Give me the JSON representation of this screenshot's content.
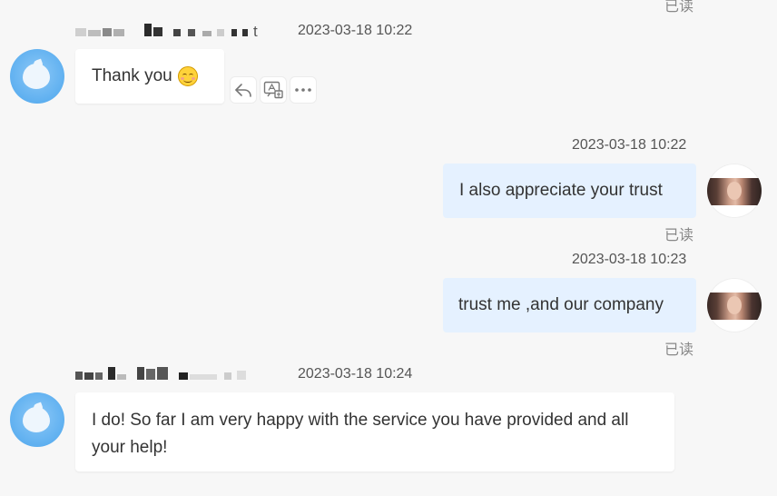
{
  "messages": [
    {
      "read_status": "已读"
    },
    {
      "sender_tail": "t",
      "timestamp": "2023-03-18 10:22",
      "text": "Thank you"
    },
    {
      "timestamp": "2023-03-18 10:22",
      "text": "I also appreciate your trust",
      "read_status": "已读"
    },
    {
      "timestamp": "2023-03-18 10:23",
      "text": "trust me ,and our company",
      "read_status": "已读"
    },
    {
      "timestamp": "2023-03-18 10:24",
      "text": "I do! So far I am very happy with the service you have provided and all your help!"
    }
  ],
  "icons": {
    "reply": "reply-icon",
    "translate": "translate-icon",
    "more": "more-icon",
    "emoji": "smile-emoji-icon"
  },
  "colors": {
    "outgoing_bubble": "#e5f1ff",
    "incoming_bubble": "#ffffff",
    "background": "#f7f7f7"
  }
}
